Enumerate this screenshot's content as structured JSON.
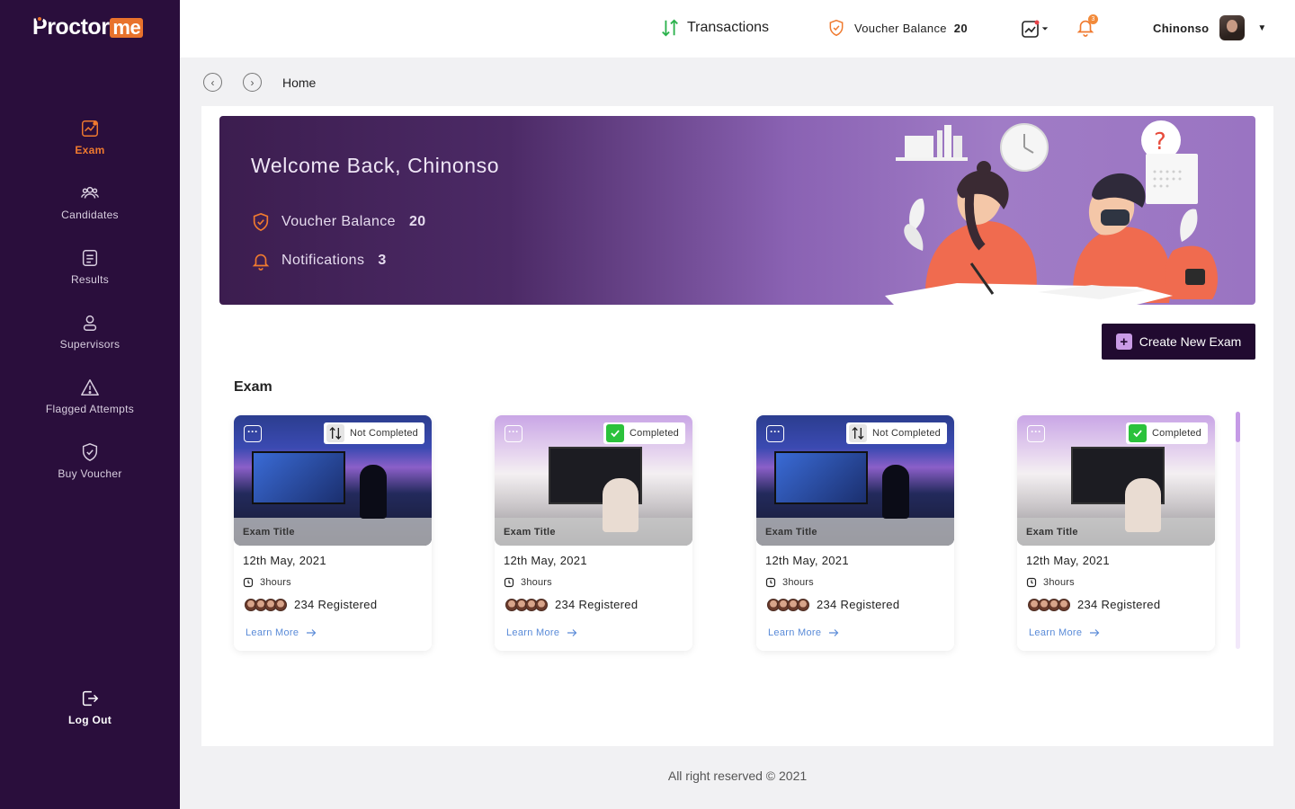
{
  "brand": {
    "logo_p": "P",
    "logo_rest": "roctor",
    "logo_me": "me"
  },
  "sidebar": {
    "items": [
      {
        "label": "Exam",
        "icon": "chart-icon",
        "active": true
      },
      {
        "label": "Candidates",
        "icon": "users-icon"
      },
      {
        "label": "Results",
        "icon": "document-icon"
      },
      {
        "label": "Supervisors",
        "icon": "user-icon"
      },
      {
        "label": "Flagged Attempts",
        "icon": "warning-icon"
      },
      {
        "label": "Buy Voucher",
        "icon": "shield-icon"
      }
    ],
    "logout_label": "Log Out"
  },
  "header": {
    "transactions_label": "Transactions",
    "voucher_label": "Voucher Balance",
    "voucher_value": "20",
    "notification_count": "3",
    "user_name": "Chinonso"
  },
  "breadcrumb": {
    "current": "Home"
  },
  "banner": {
    "title": "Welcome Back, Chinonso",
    "voucher_label": "Voucher Balance",
    "voucher_value": "20",
    "notifications_label": "Notifications",
    "notifications_value": "3"
  },
  "actions": {
    "create_exam_label": "Create New Exam"
  },
  "exam_section": {
    "title": "Exam",
    "cards": [
      {
        "status": "Not Completed",
        "title": "Exam Title",
        "date": "12th May, 2021",
        "duration": "3hours",
        "registered": "234 Registered",
        "link": "Learn More"
      },
      {
        "status": "Completed",
        "title": "Exam Title",
        "date": "12th May, 2021",
        "duration": "3hours",
        "registered": "234 Registered",
        "link": "Learn More"
      },
      {
        "status": "Not Completed",
        "title": "Exam Title",
        "date": "12th May, 2021",
        "duration": "3hours",
        "registered": "234 Registered",
        "link": "Learn More"
      },
      {
        "status": "Completed",
        "title": "Exam Title",
        "date": "12th May, 2021",
        "duration": "3hours",
        "registered": "234 Registered",
        "link": "Learn More"
      }
    ]
  },
  "footer": {
    "text": "All right reserved ©  2021"
  },
  "colors": {
    "sidebar": "#2a0e3c",
    "accent": "#f07a2f",
    "primary_button": "#210a30",
    "completed": "#2bc23b",
    "link": "#5a8bd8"
  }
}
